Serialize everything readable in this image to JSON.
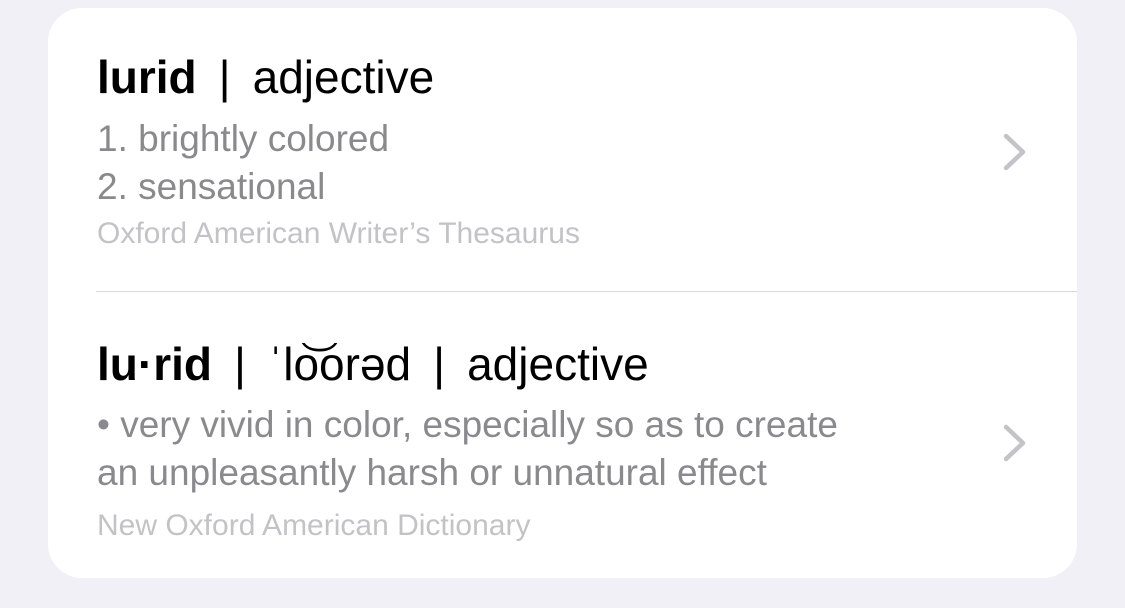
{
  "entries": [
    {
      "headword": "lurid",
      "separator": "|",
      "part_of_speech": "adjective",
      "definitions": [
        "1. brightly colored",
        "2. sensational"
      ],
      "source": "Oxford American Writer’s Thesaurus",
      "chevron_icon": "chevron-right-icon"
    },
    {
      "headword": "lu·rid",
      "separator": "|",
      "pronunciation": "ˈlo͝orəd",
      "part_of_speech": "adjective",
      "definitions": [
        "• very vivid in color, especially so as to create",
        "an unpleasantly harsh or unnatural effect"
      ],
      "source": "New Oxford American Dictionary",
      "chevron_icon": "chevron-right-icon"
    }
  ],
  "colors": {
    "background": "#f1f0f6",
    "card": "#ffffff",
    "headline": "#000000",
    "definition": "#8a8a8e",
    "source": "#c3c3c7",
    "chevron": "#c4c4c8"
  }
}
